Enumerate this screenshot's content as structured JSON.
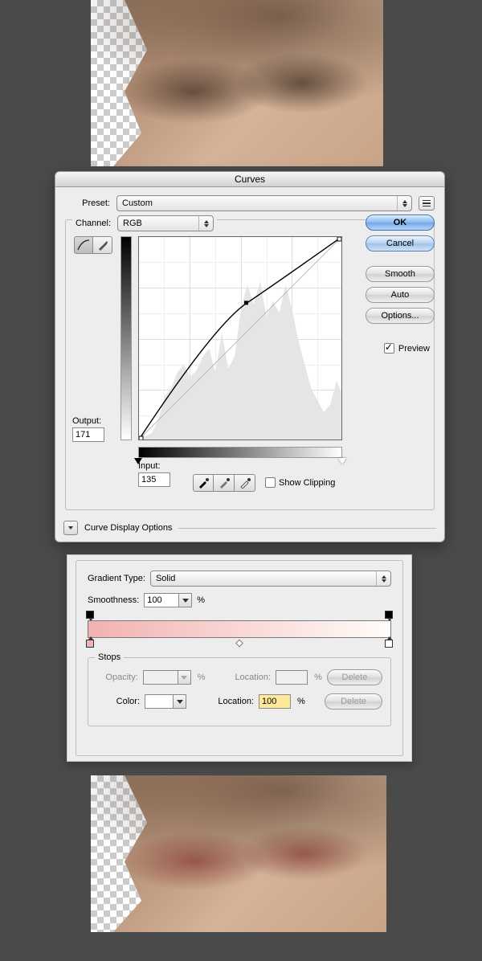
{
  "curves": {
    "title": "Curves",
    "preset_label": "Preset:",
    "preset_value": "Custom",
    "channel_label": "Channel:",
    "channel_value": "RGB",
    "output_label": "Output:",
    "output_value": "171",
    "input_label": "Input:",
    "input_value": "135",
    "show_clipping": "Show Clipping",
    "display_options": "Curve Display Options",
    "buttons": {
      "ok": "OK",
      "cancel": "Cancel",
      "smooth": "Smooth",
      "auto": "Auto",
      "options": "Options..."
    },
    "preview_label": "Preview"
  },
  "gradient": {
    "type_label": "Gradient Type:",
    "type_value": "Solid",
    "smoothness_label": "Smoothness:",
    "smoothness_value": "100",
    "pct": "%",
    "stops_label": "Stops",
    "opacity_label": "Opacity:",
    "opacity_value": "",
    "opacity_loc_label": "Location:",
    "opacity_loc_value": "",
    "color_label": "Color:",
    "color_loc_label": "Location:",
    "color_loc_value": "100",
    "delete": "Delete"
  }
}
